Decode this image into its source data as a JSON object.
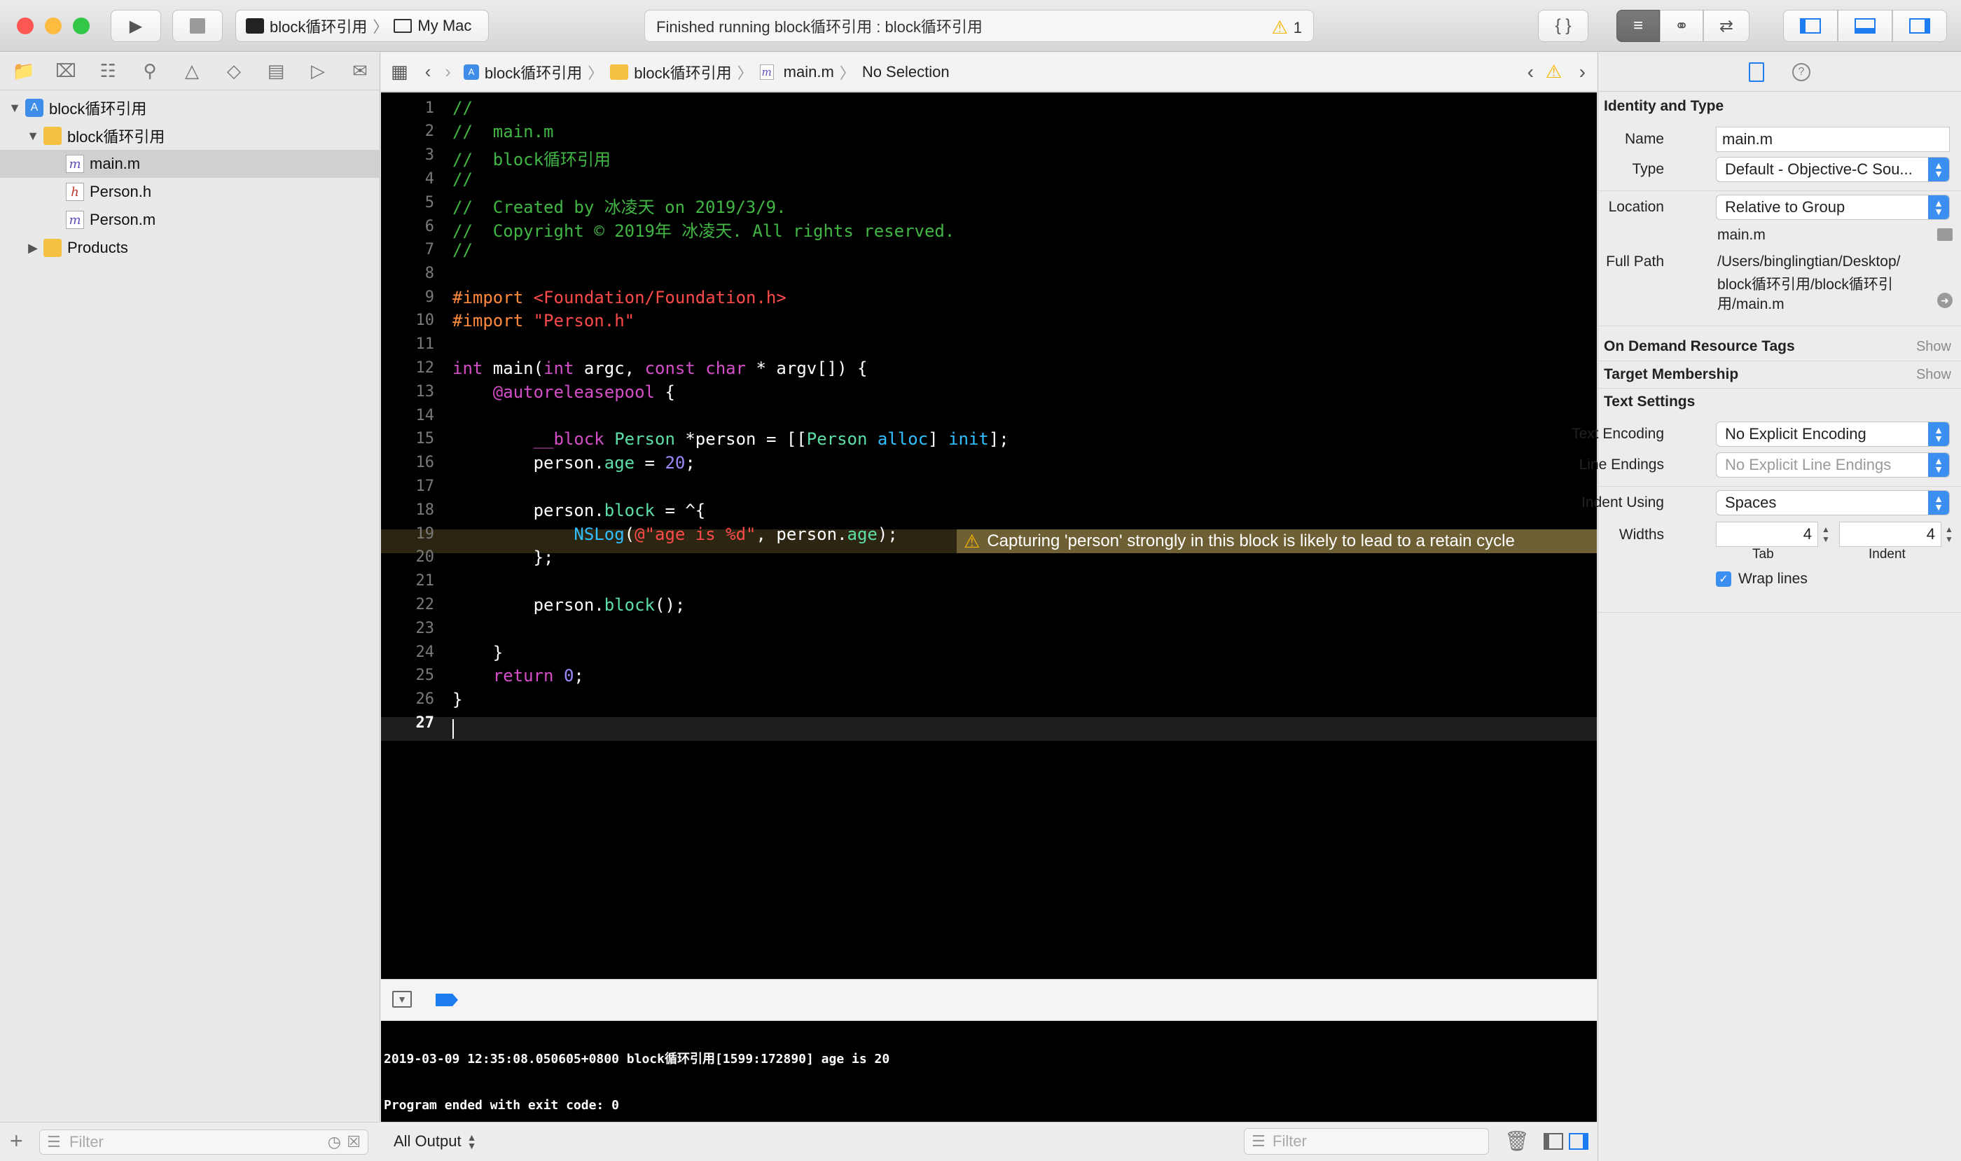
{
  "toolbar": {
    "scheme_name": "block循环引用",
    "destination": "My Mac",
    "status_text": "Finished running block循环引用 : block循环引用",
    "warning_count": "1"
  },
  "navigator": {
    "items": [
      {
        "label": "block循环引用"
      },
      {
        "label": "block循环引用"
      },
      {
        "label": "main.m"
      },
      {
        "label": "Person.h"
      },
      {
        "label": "Person.m"
      },
      {
        "label": "Products"
      }
    ],
    "filter_placeholder": "Filter"
  },
  "jumpbar": {
    "crumbs": [
      "block循环引用",
      "block循环引用",
      "main.m",
      "No Selection"
    ]
  },
  "code": {
    "line_numbers": [
      "1",
      "2",
      "3",
      "4",
      "5",
      "6",
      "7",
      "8",
      "9",
      "10",
      "11",
      "12",
      "13",
      "14",
      "15",
      "16",
      "17",
      "18",
      "19",
      "20",
      "21",
      "22",
      "23",
      "24",
      "25",
      "26",
      "27"
    ],
    "l1": "//",
    "l2": "//  main.m",
    "l3": "//  block循环引用",
    "l4": "//",
    "l5": "//  Created by 冰凌天 on 2019/3/9.",
    "l6": "//  Copyright © 2019年 冰凌天. All rights reserved.",
    "l7": "//",
    "l9a": "#import ",
    "l9b": "<Foundation/Foundation.h>",
    "l10a": "#import ",
    "l10b": "\"Person.h\"",
    "l12a": "int",
    "l12b": " main(",
    "l12c": "int",
    "l12d": " argc, ",
    "l12e": "const",
    "l12f": " ",
    "l12g": "char",
    "l12h": " * argv[]) {",
    "l13a": "    ",
    "l13b": "@autoreleasepool",
    "l13c": " {",
    "l15a": "        ",
    "l15b": "__block",
    "l15c": " ",
    "l15d": "Person",
    "l15e": " *person = [[",
    "l15f": "Person",
    "l15g": " ",
    "l15h": "alloc",
    "l15i": "] ",
    "l15j": "init",
    "l15k": "];",
    "l16a": "        person.",
    "l16b": "age",
    "l16c": " = ",
    "l16d": "20",
    "l16e": ";",
    "l18a": "        person.",
    "l18b": "block",
    "l18c": " = ^{",
    "l19a": "            ",
    "l19b": "NSLog",
    "l19c": "(",
    "l19d": "@\"age is %d\"",
    "l19e": ", person.",
    "l19f": "age",
    "l19g": ");",
    "l20": "        };",
    "l22a": "        person.",
    "l22b": "block",
    "l22c": "();",
    "l24": "    }",
    "l25a": "    ",
    "l25b": "return",
    "l25c": " ",
    "l25d": "0",
    "l25e": ";",
    "l26": "}",
    "warning_message": "Capturing 'person' strongly in this block is likely to lead to a retain cycle"
  },
  "console": {
    "lines": [
      "2019-03-09 12:35:08.050605+0800 block循环引用[1599:172890] age is 20",
      "Program ended with exit code: 0"
    ],
    "output_selector": "All Output",
    "filter_placeholder": "Filter"
  },
  "inspector": {
    "identity_title": "Identity and Type",
    "name_label": "Name",
    "name_value": "main.m",
    "type_label": "Type",
    "type_value": "Default - Objective-C Sou...",
    "location_label": "Location",
    "location_value": "Relative to Group",
    "location_file": "main.m",
    "fullpath_label": "Full Path",
    "fullpath_lines": [
      "/Users/binglingtian/Desktop/",
      "block循环引用/block循环引",
      "用/main.m"
    ],
    "odrt_title": "On Demand Resource Tags",
    "target_title": "Target Membership",
    "show_label": "Show",
    "text_settings_title": "Text Settings",
    "encoding_label": "Text Encoding",
    "encoding_value": "No Explicit Encoding",
    "line_endings_label": "Line Endings",
    "line_endings_value": "No Explicit Line Endings",
    "indent_using_label": "Indent Using",
    "indent_using_value": "Spaces",
    "widths_label": "Widths",
    "tab_width": "4",
    "indent_width": "4",
    "tab_label": "Tab",
    "indent_label": "Indent",
    "wrap_lines_label": "Wrap lines"
  },
  "colors": {
    "accent": "#1d7cf2",
    "editor_bg": "#000000",
    "comment": "#41b645",
    "keyword": "#d44ec8",
    "warning_bg": "#6e6034"
  }
}
